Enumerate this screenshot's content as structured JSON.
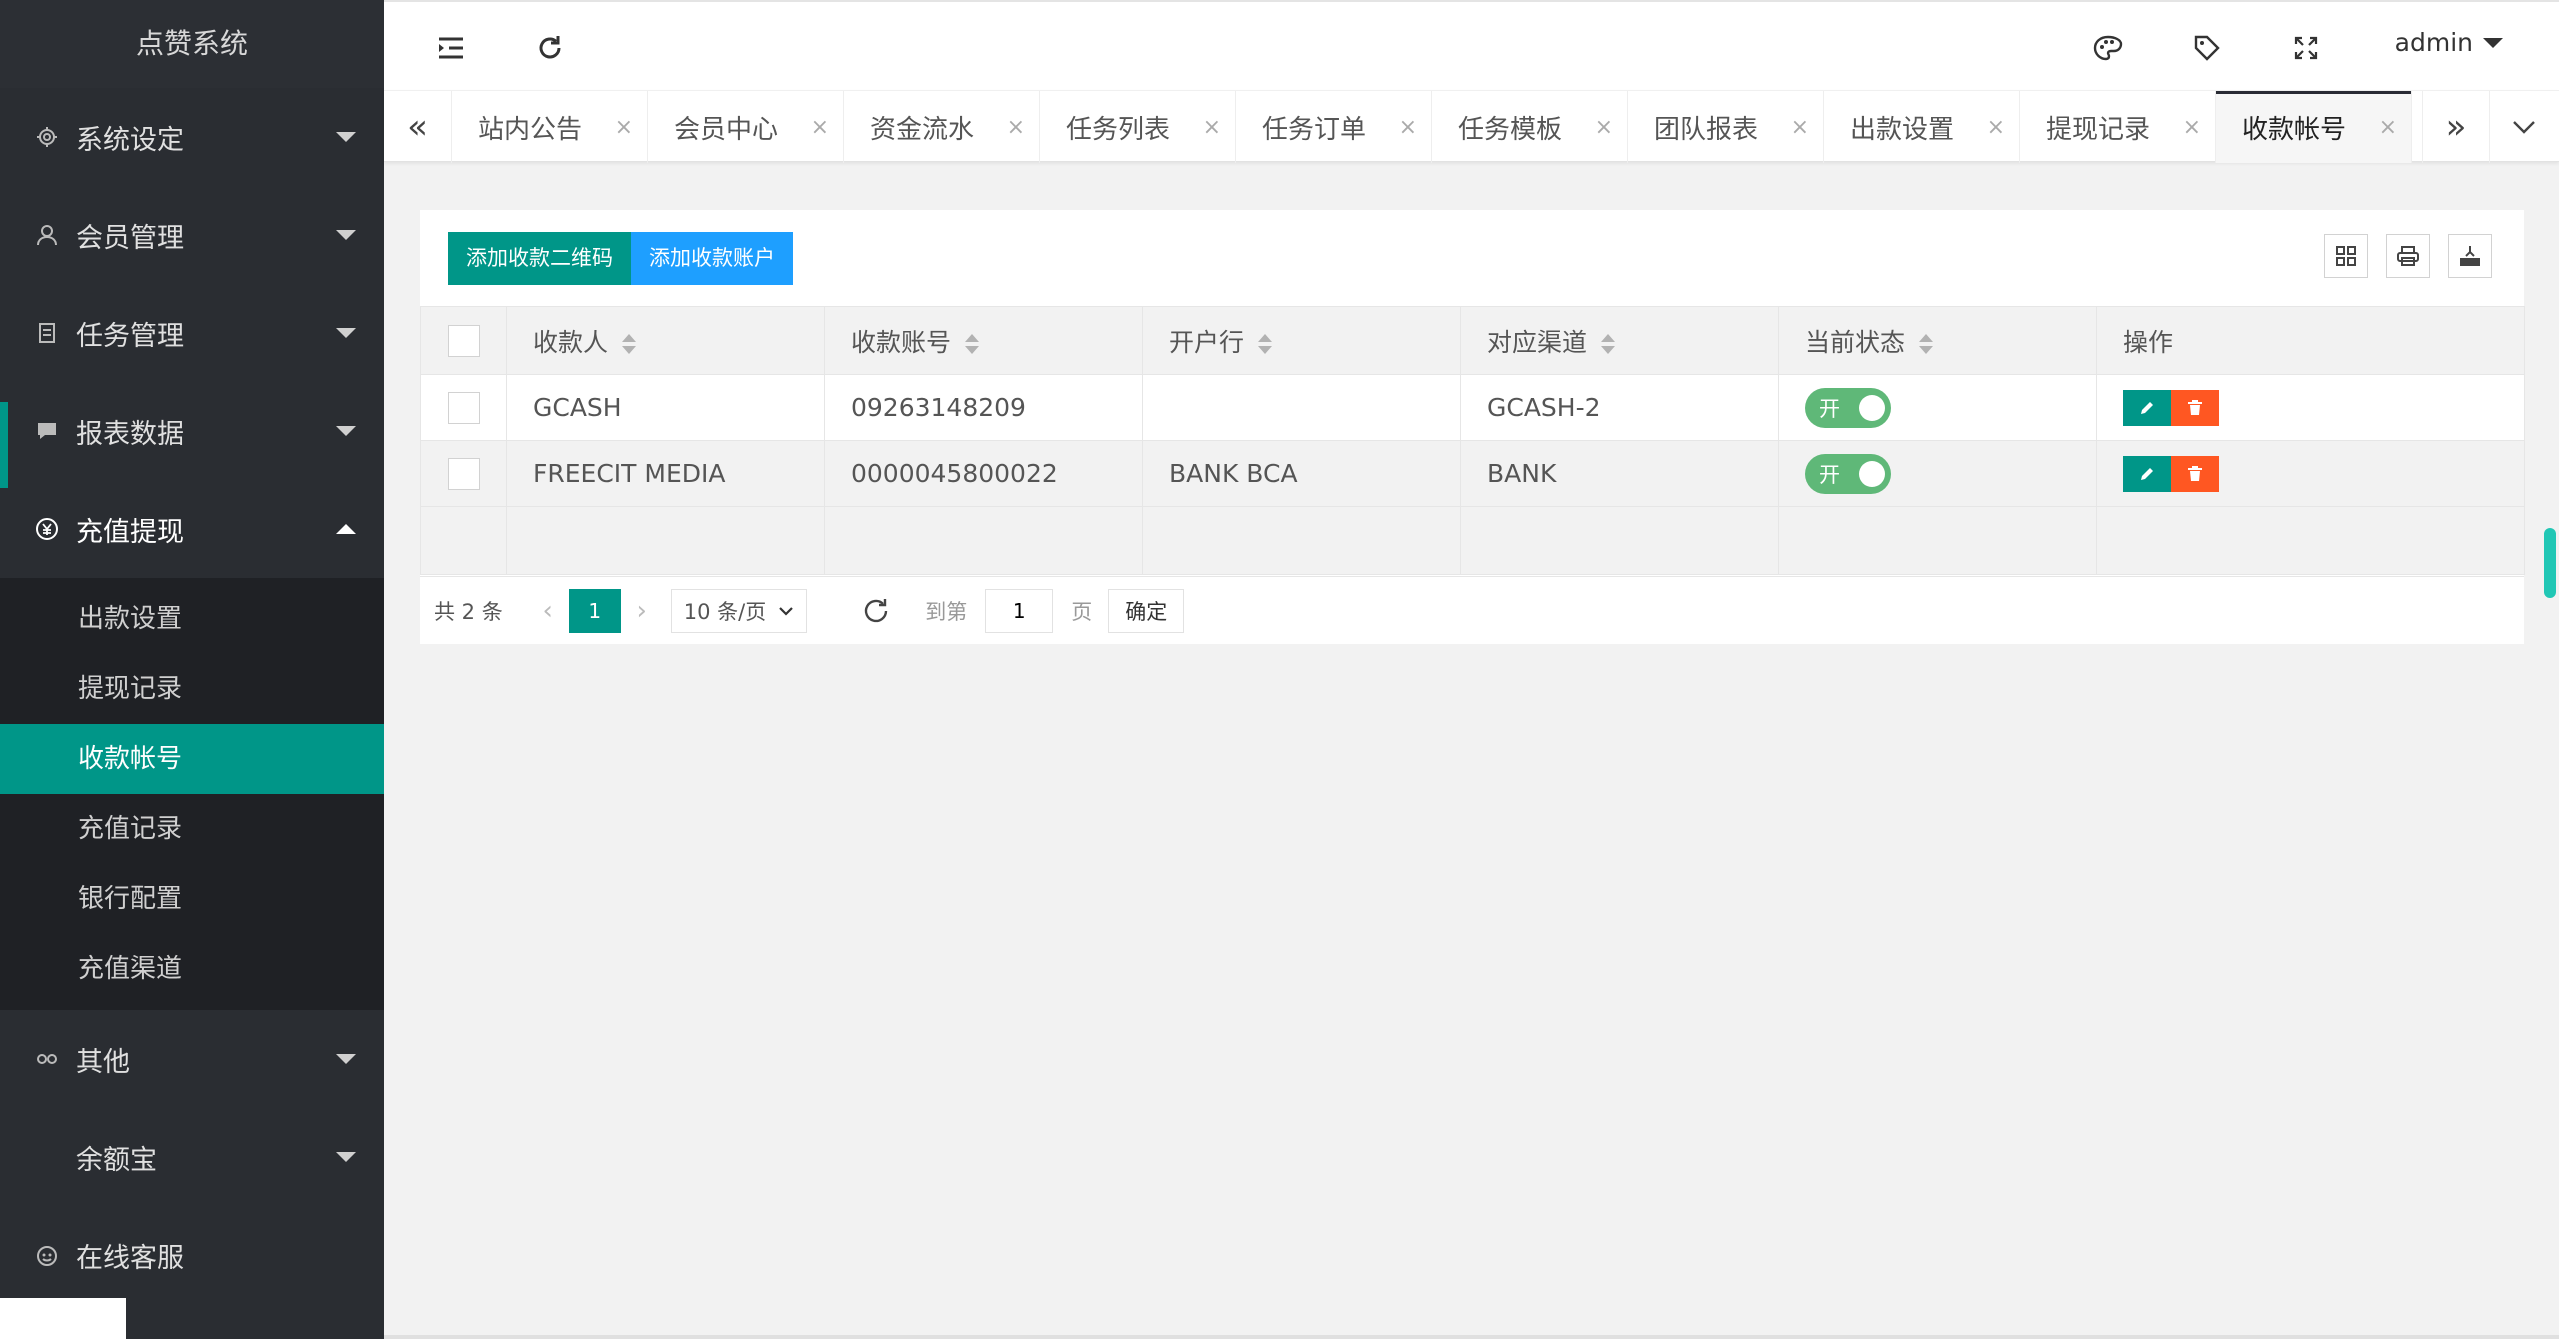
{
  "app": {
    "title": "点赞系统"
  },
  "sidebar": {
    "items": [
      {
        "label": "系统设定",
        "icon": "gear-icon"
      },
      {
        "label": "会员管理",
        "icon": "user-icon"
      },
      {
        "label": "任务管理",
        "icon": "document-icon"
      },
      {
        "label": "报表数据",
        "icon": "chat-icon"
      },
      {
        "label": "充值提现",
        "icon": "yen-icon"
      },
      {
        "label": "其他",
        "icon": "link-icon"
      },
      {
        "label": "余额宝",
        "icon": ""
      },
      {
        "label": "在线客服",
        "icon": "face-icon"
      }
    ],
    "submenu": [
      "出款设置",
      "提现记录",
      "收款帐号",
      "充值记录",
      "银行配置",
      "充值渠道"
    ],
    "active_submenu": "收款帐号"
  },
  "header": {
    "user": "admin",
    "icons": [
      "menu-fold-icon",
      "refresh-icon",
      "theme-icon",
      "tag-icon",
      "fullscreen-icon"
    ]
  },
  "tabs": {
    "items": [
      "站内公告",
      "会员中心",
      "资金流水",
      "任务列表",
      "任务订单",
      "任务模板",
      "团队报表",
      "出款设置",
      "提现记录",
      "收款帐号"
    ],
    "active": "收款帐号",
    "close_glyph": "×"
  },
  "toolbar": {
    "add_qr_label": "添加收款二维码",
    "add_account_label": "添加收款账户"
  },
  "table": {
    "columns": [
      "收款人",
      "收款账号",
      "开户行",
      "对应渠道",
      "当前状态",
      "操作"
    ],
    "rows": [
      {
        "payee": "GCASH",
        "account": "09263148209",
        "bank": "",
        "channel": "GCASH-2",
        "status": "开"
      },
      {
        "payee": "FREECIT MEDIA",
        "account": "0000045800022",
        "bank": "BANK BCA",
        "channel": "BANK",
        "status": "开"
      }
    ]
  },
  "pager": {
    "total": "共 2 条",
    "current_page": "1",
    "page_size": "10 条/页",
    "goto_label": "到第",
    "goto_value": "1",
    "page_unit": "页",
    "confirm_label": "确定"
  },
  "colors": {
    "sidebar_bg": "#2a2d32",
    "accent": "#009688",
    "blue": "#1e9fff",
    "switch_on": "#5fb878",
    "danger": "#ff5722"
  }
}
